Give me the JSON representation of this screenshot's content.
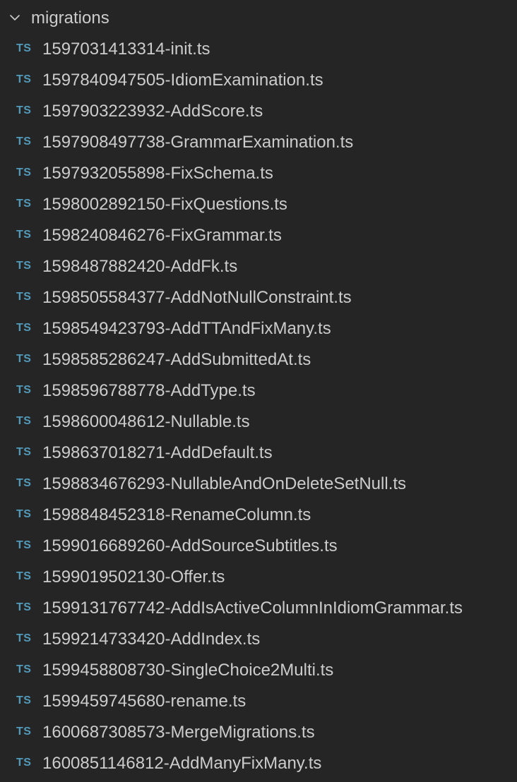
{
  "explorer": {
    "folder": {
      "name": "migrations",
      "expanded": true,
      "chevron_icon": "chevron-down-icon"
    },
    "file_icon": {
      "name": "typescript-icon",
      "glyph": "TS",
      "color": "#519aba"
    },
    "files": [
      {
        "name": "1597031413314-init.ts"
      },
      {
        "name": "1597840947505-IdiomExamination.ts"
      },
      {
        "name": "1597903223932-AddScore.ts"
      },
      {
        "name": "1597908497738-GrammarExamination.ts"
      },
      {
        "name": "1597932055898-FixSchema.ts"
      },
      {
        "name": "1598002892150-FixQuestions.ts"
      },
      {
        "name": "1598240846276-FixGrammar.ts"
      },
      {
        "name": "1598487882420-AddFk.ts"
      },
      {
        "name": "1598505584377-AddNotNullConstraint.ts"
      },
      {
        "name": "1598549423793-AddTTAndFixMany.ts"
      },
      {
        "name": "1598585286247-AddSubmittedAt.ts"
      },
      {
        "name": "1598596788778-AddType.ts"
      },
      {
        "name": "1598600048612-Nullable.ts"
      },
      {
        "name": "1598637018271-AddDefault.ts"
      },
      {
        "name": "1598834676293-NullableAndOnDeleteSetNull.ts"
      },
      {
        "name": "1598848452318-RenameColumn.ts"
      },
      {
        "name": "1599016689260-AddSourceSubtitles.ts"
      },
      {
        "name": "1599019502130-Offer.ts"
      },
      {
        "name": "1599131767742-AddIsActiveColumnInIdiomGrammar.ts"
      },
      {
        "name": "1599214733420-AddIndex.ts"
      },
      {
        "name": "1599458808730-SingleChoice2Multi.ts"
      },
      {
        "name": "1599459745680-rename.ts"
      },
      {
        "name": "1600687308573-MergeMigrations.ts"
      },
      {
        "name": "1600851146812-AddManyFixMany.ts"
      }
    ]
  },
  "colors": {
    "background": "#252526",
    "text": "#cccccc",
    "ts_icon": "#519aba"
  }
}
